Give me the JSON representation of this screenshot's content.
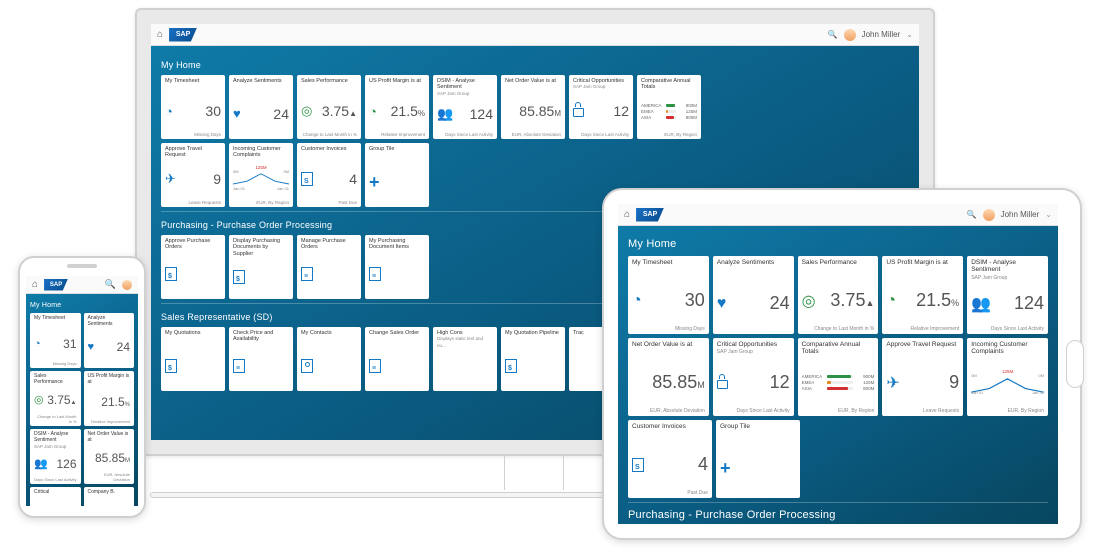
{
  "brand": "SAP",
  "user": {
    "name": "John Miller"
  },
  "sections": {
    "home": "My Home",
    "purchasing": "Purchasing - Purchase Order Processing",
    "sales": "Sales Representative (SD)"
  },
  "tiles": {
    "timesheet": {
      "title": "My Timesheet",
      "value": "30",
      "value_phone": "31",
      "footer": "Missing Days"
    },
    "sentiments": {
      "title": "Analyze Sentiments",
      "value": "24",
      "footer": ""
    },
    "salesperf": {
      "title": "Sales Performance",
      "value": "3.75",
      "arrow": "▲",
      "unit": "%",
      "footer": "Change to Last Month in %"
    },
    "profit": {
      "title": "US Profit Margin is at",
      "value": "21.5",
      "unit": "%",
      "footer": "Relative Improvement"
    },
    "dsim": {
      "title": "DSIM - Analyse Sentiment",
      "sub": "SAP Jam Group",
      "value": "124",
      "footer": "Days Since Last Activity"
    },
    "netorder": {
      "title": "Net Order Value is at",
      "value": "85.85",
      "unit": "M",
      "footer": "EUR, Absolute Deviation"
    },
    "critical": {
      "title": "Critical Opportunities",
      "sub": "SAP Jam Group",
      "value": "12",
      "footer": "Days Since Last Activity"
    },
    "annual": {
      "title": "Comparative Annual Totals",
      "rows": [
        {
          "label": "AMERICA",
          "val": "900M",
          "pct": 90,
          "color": "#2e9246"
        },
        {
          "label": "EMEA",
          "val": "125M",
          "pct": 15,
          "color": "#e08b1e"
        },
        {
          "label": "ASIA",
          "val": "800M",
          "pct": 80,
          "color": "#d32f2f"
        }
      ],
      "footer": "EUR, By Region"
    },
    "travel": {
      "title": "Approve Travel Request",
      "value": "9",
      "footer": "Leave Requests"
    },
    "complaints": {
      "title": "Incoming Customer Complaints",
      "peak": "125M",
      "left": "Jan 01",
      "right": "Jan 31",
      "tl": "0M",
      "tr": "0M",
      "footer": "EUR, By Region"
    },
    "invoices": {
      "title": "Customer Invoices",
      "value": "4",
      "footer": "Past Due"
    },
    "group": {
      "title": "Group Tile"
    },
    "approve_po": {
      "title": "Approve Purchase Orders"
    },
    "display_po": {
      "title": "Display Purchasing Documents by Supplier"
    },
    "manage_po": {
      "title": "Manage Purchase Orders"
    },
    "my_po_items": {
      "title": "My Purchasing Document Items"
    },
    "quotations": {
      "title": "My Quotations"
    },
    "checkprice": {
      "title": "Check Price and Availability"
    },
    "contacts": {
      "title": "My Contacts"
    },
    "changeorder": {
      "title": "Change Sales Order"
    },
    "highcons": {
      "title": "High Cons",
      "sub": "Displays static text and nu..."
    },
    "pipeline": {
      "title": "My Quotation Pipeline"
    },
    "track": {
      "title": "Trac"
    },
    "phone_dsim": {
      "title": "DSIM - Analyse Sentiment",
      "sub": "SAP Jam Group",
      "value": "126",
      "footer": "Days Since Last Activity"
    },
    "phone_crit": {
      "title": "Critical"
    },
    "phone_comp": {
      "title": "Company B."
    }
  }
}
